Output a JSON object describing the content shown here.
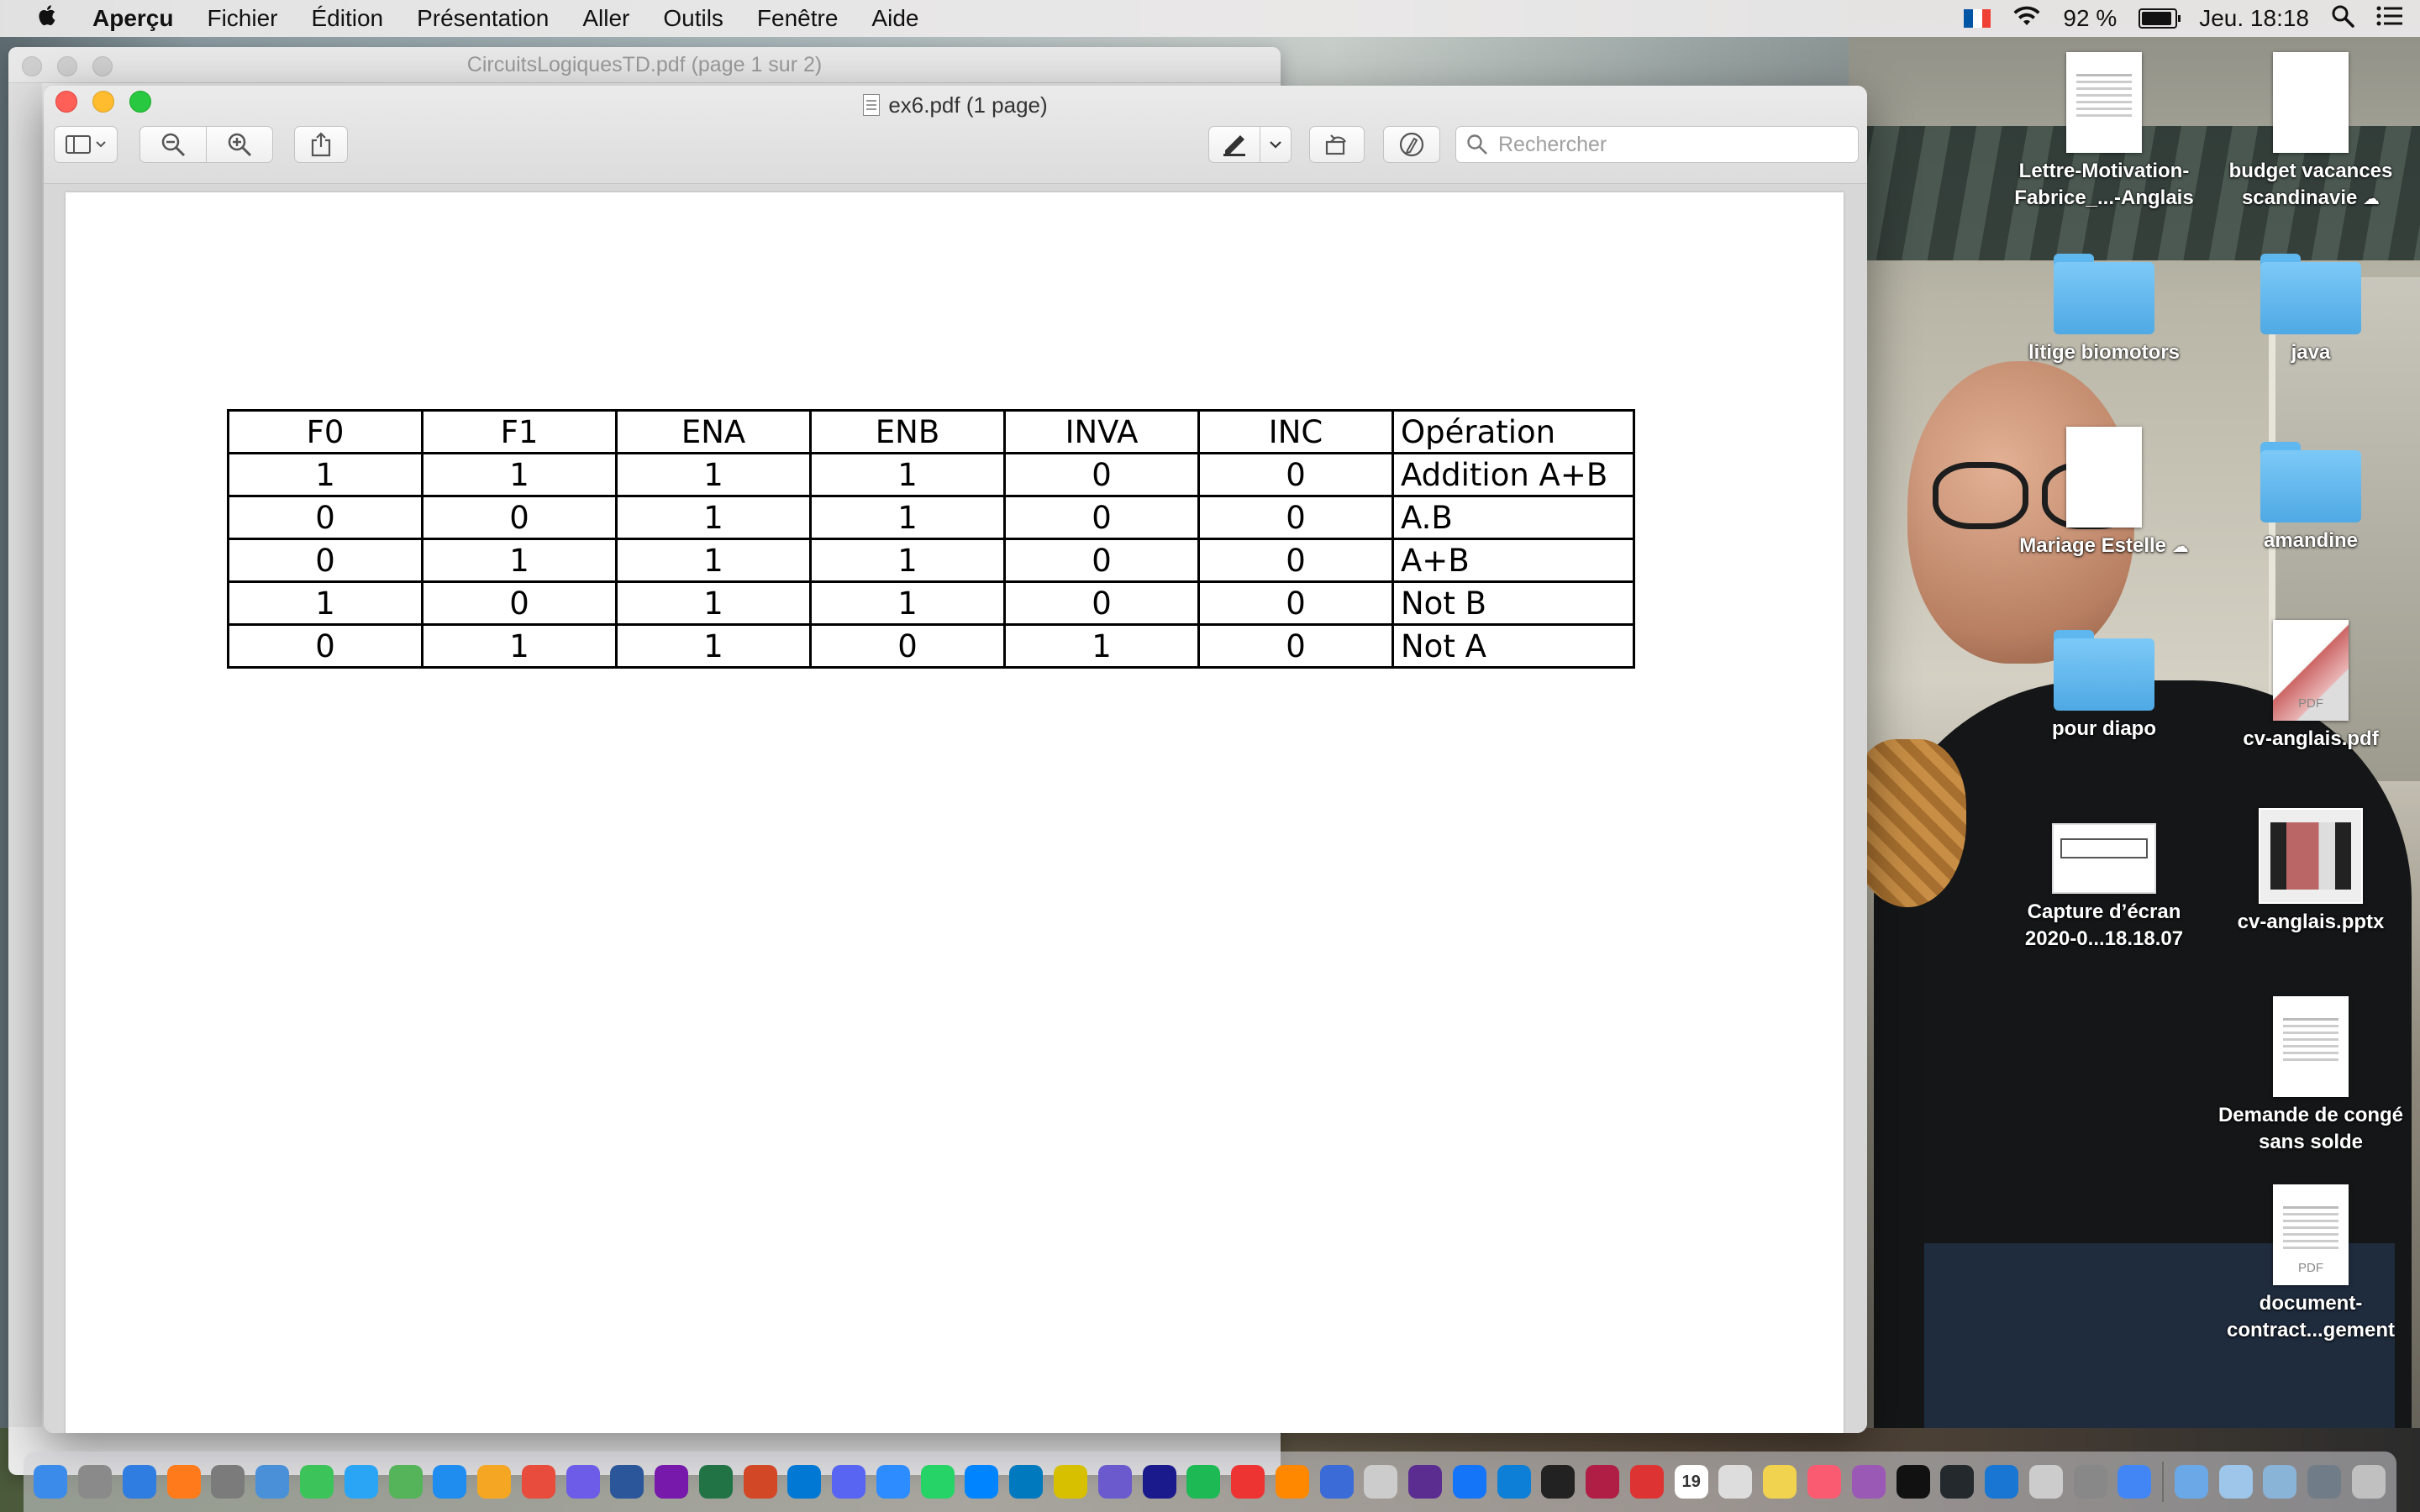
{
  "menubar": {
    "app_name": "Aperçu",
    "items": [
      "Fichier",
      "Édition",
      "Présentation",
      "Aller",
      "Outils",
      "Fenêtre",
      "Aide"
    ],
    "battery": "92 %",
    "clock": "Jeu. 18:18"
  },
  "background_window": {
    "title": "CircuitsLogiquesTD.pdf (page 1 sur 2)"
  },
  "window": {
    "title": "ex6.pdf (1 page)",
    "search_placeholder": "Rechercher"
  },
  "table": {
    "headers": [
      "F0",
      "F1",
      "ENA",
      "ENB",
      "INVA",
      "INC",
      "Opération"
    ],
    "rows": [
      [
        "1",
        "1",
        "1",
        "1",
        "0",
        "0",
        "Addition A+B"
      ],
      [
        "0",
        "0",
        "1",
        "1",
        "0",
        "0",
        "A.B"
      ],
      [
        "0",
        "1",
        "1",
        "1",
        "0",
        "0",
        "A+B"
      ],
      [
        "1",
        "0",
        "1",
        "1",
        "0",
        "0",
        "Not B"
      ],
      [
        "0",
        "1",
        "1",
        "0",
        "1",
        "0",
        "Not A"
      ]
    ]
  },
  "desktop": {
    "icons": [
      {
        "label": "Lettre-Motivation-Fabrice_...-Anglais",
        "kind": "document"
      },
      {
        "label": "budget vacances scandinavie",
        "kind": "document",
        "cloud": true
      },
      {
        "label": "litige biomotors",
        "kind": "folder"
      },
      {
        "label": "java",
        "kind": "folder"
      },
      {
        "label": "Mariage Estelle",
        "kind": "document",
        "cloud": true
      },
      {
        "label": "amandine",
        "kind": "folder"
      },
      {
        "label": "pour diapo",
        "kind": "folder"
      },
      {
        "label": "cv-anglais.pdf",
        "kind": "pdf"
      },
      {
        "label": "Capture d’écran 2020-0...18.18.07",
        "kind": "screenshot"
      },
      {
        "label": "cv-anglais.pptx",
        "kind": "pptx"
      },
      {
        "label": "Demande de congé sans solde",
        "kind": "document"
      },
      {
        "label": "document-contract...gement",
        "kind": "pdf"
      }
    ],
    "pdf_badge": "PDF"
  },
  "dock": {
    "apps": [
      "Finder",
      "Launchpad",
      "Safari",
      "Firefox",
      "Préférences Système",
      "Aperçu",
      "Messages",
      "Messages",
      "Plans",
      "App Store",
      "Photos",
      "Calendrier",
      "Chrome Canary",
      "Word",
      "OneNote",
      "Excel",
      "PowerPoint",
      "Outlook",
      "Discord",
      "Zoom",
      "WhatsApp",
      "Messenger",
      "Trello",
      "Mendeley",
      "iMovie",
      "Audacity",
      "Spotify",
      "Lecteur",
      "VLC",
      "Étoiles",
      "Dent",
      "Visual Studio",
      "Xcode",
      "VS Code",
      "Terminal",
      "Affinity",
      "PDF",
      "Calendrier",
      "Notes",
      "Notes",
      "Musique",
      "Podcasts",
      "Apple TV",
      "GitHub",
      "Team",
      "Outil",
      "Photos",
      "Chrome",
      "Dossier",
      "Dossier",
      "Dossier",
      "Dossier",
      "Corbeille"
    ],
    "calendar_day": "19"
  }
}
